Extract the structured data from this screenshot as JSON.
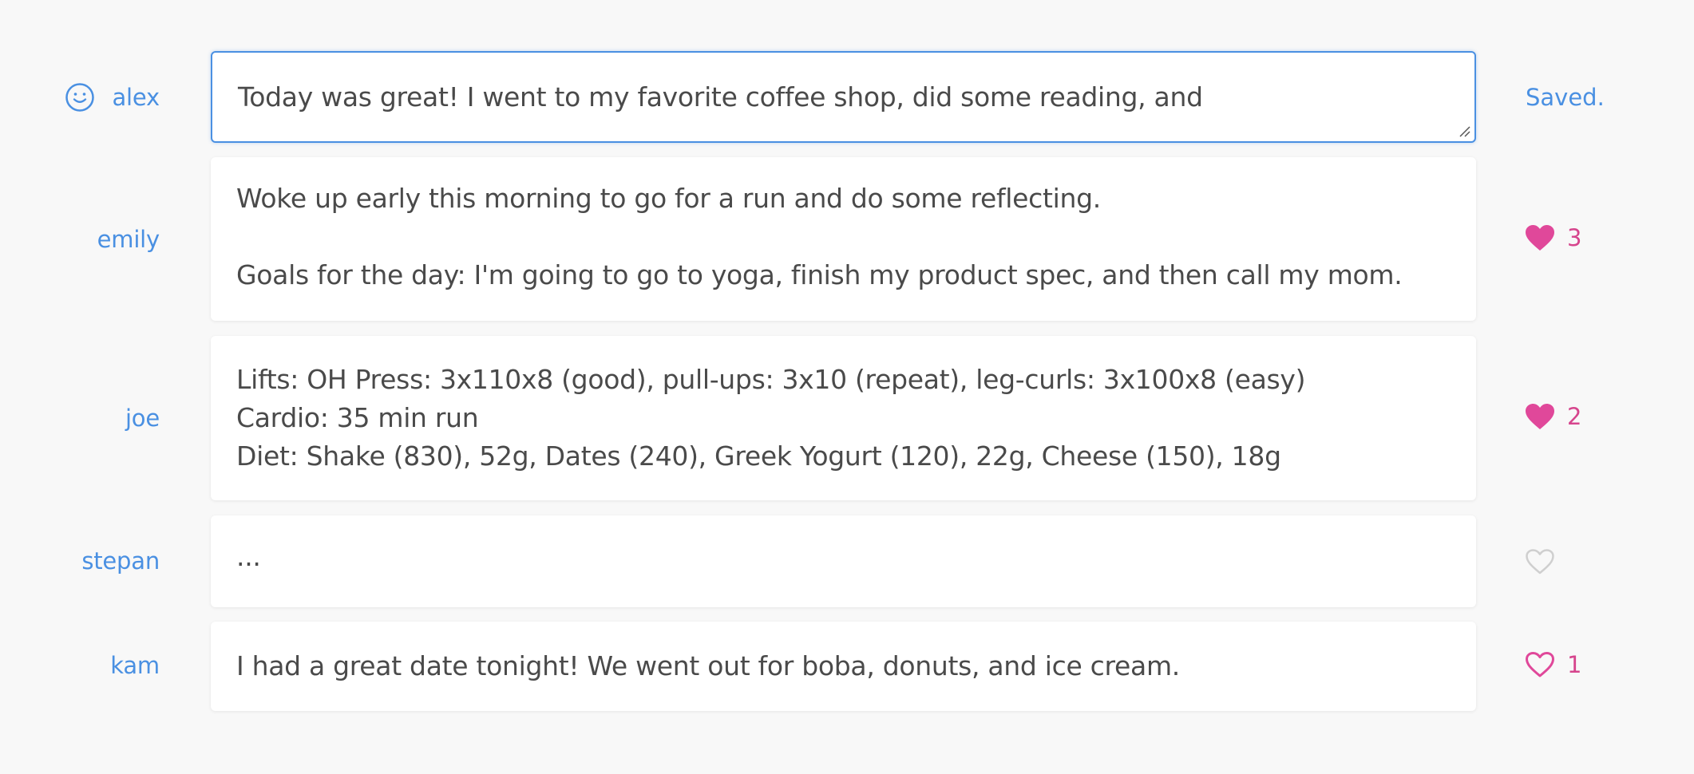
{
  "colors": {
    "accent_blue": "#4a90e2",
    "like_pink": "#e0489a",
    "text": "#4a4a4a",
    "muted_gray": "#d0d0d0"
  },
  "entries": [
    {
      "author": "alex",
      "is_current_user": true,
      "text_lines": [
        "Today was great! I went to my favorite coffee shop, did some reading, and"
      ],
      "status": "Saved."
    },
    {
      "author": "emily",
      "text_lines": [
        "Woke up early this morning to go for a run and do some reflecting.",
        "",
        "Goals for the day: I'm going to go to yoga, finish my product spec, and then call my mom."
      ],
      "like_icon": "heart-filled-icon",
      "likes": "3"
    },
    {
      "author": "joe",
      "text_lines": [
        "Lifts: OH Press: 3x110x8 (good), pull-ups: 3x10 (repeat), leg-curls: 3x100x8 (easy)",
        "Cardio: 35 min run",
        "Diet: Shake (830), 52g, Dates (240), Greek Yogurt (120), 22g, Cheese (150), 18g"
      ],
      "like_icon": "heart-filled-icon",
      "likes": "2"
    },
    {
      "author": "stepan",
      "text_lines": [
        "..."
      ],
      "like_icon": "heart-outline-icon",
      "likes": ""
    },
    {
      "author": "kam",
      "text_lines": [
        "I had a great date tonight! We went out for boba, donuts, and ice cream."
      ],
      "like_icon": "heart-outline-icon",
      "likes": "1"
    }
  ]
}
